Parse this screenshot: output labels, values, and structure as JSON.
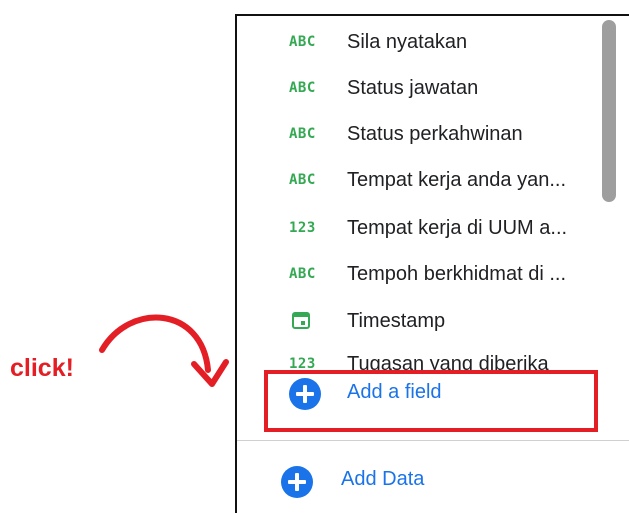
{
  "fields": [
    {
      "type": "ABC",
      "label": "Sila nyatakan"
    },
    {
      "type": "ABC",
      "label": "Status jawatan"
    },
    {
      "type": "ABC",
      "label": "Status perkahwinan"
    },
    {
      "type": "ABC",
      "label": "Tempat kerja anda yan..."
    },
    {
      "type": "123",
      "label": "Tempat kerja di UUM a..."
    },
    {
      "type": "ABC",
      "label": "Tempoh berkhidmat di ..."
    },
    {
      "type": "calendar",
      "label": "Timestamp"
    },
    {
      "type": "123",
      "label": "Tugasan yang diberika"
    }
  ],
  "add_field_label": "Add a field",
  "add_data_label": "Add Data",
  "annotation": "click!",
  "colors": {
    "accent": "#1a73e8",
    "type_green": "#34a853",
    "annotation_red": "#e31e24"
  }
}
